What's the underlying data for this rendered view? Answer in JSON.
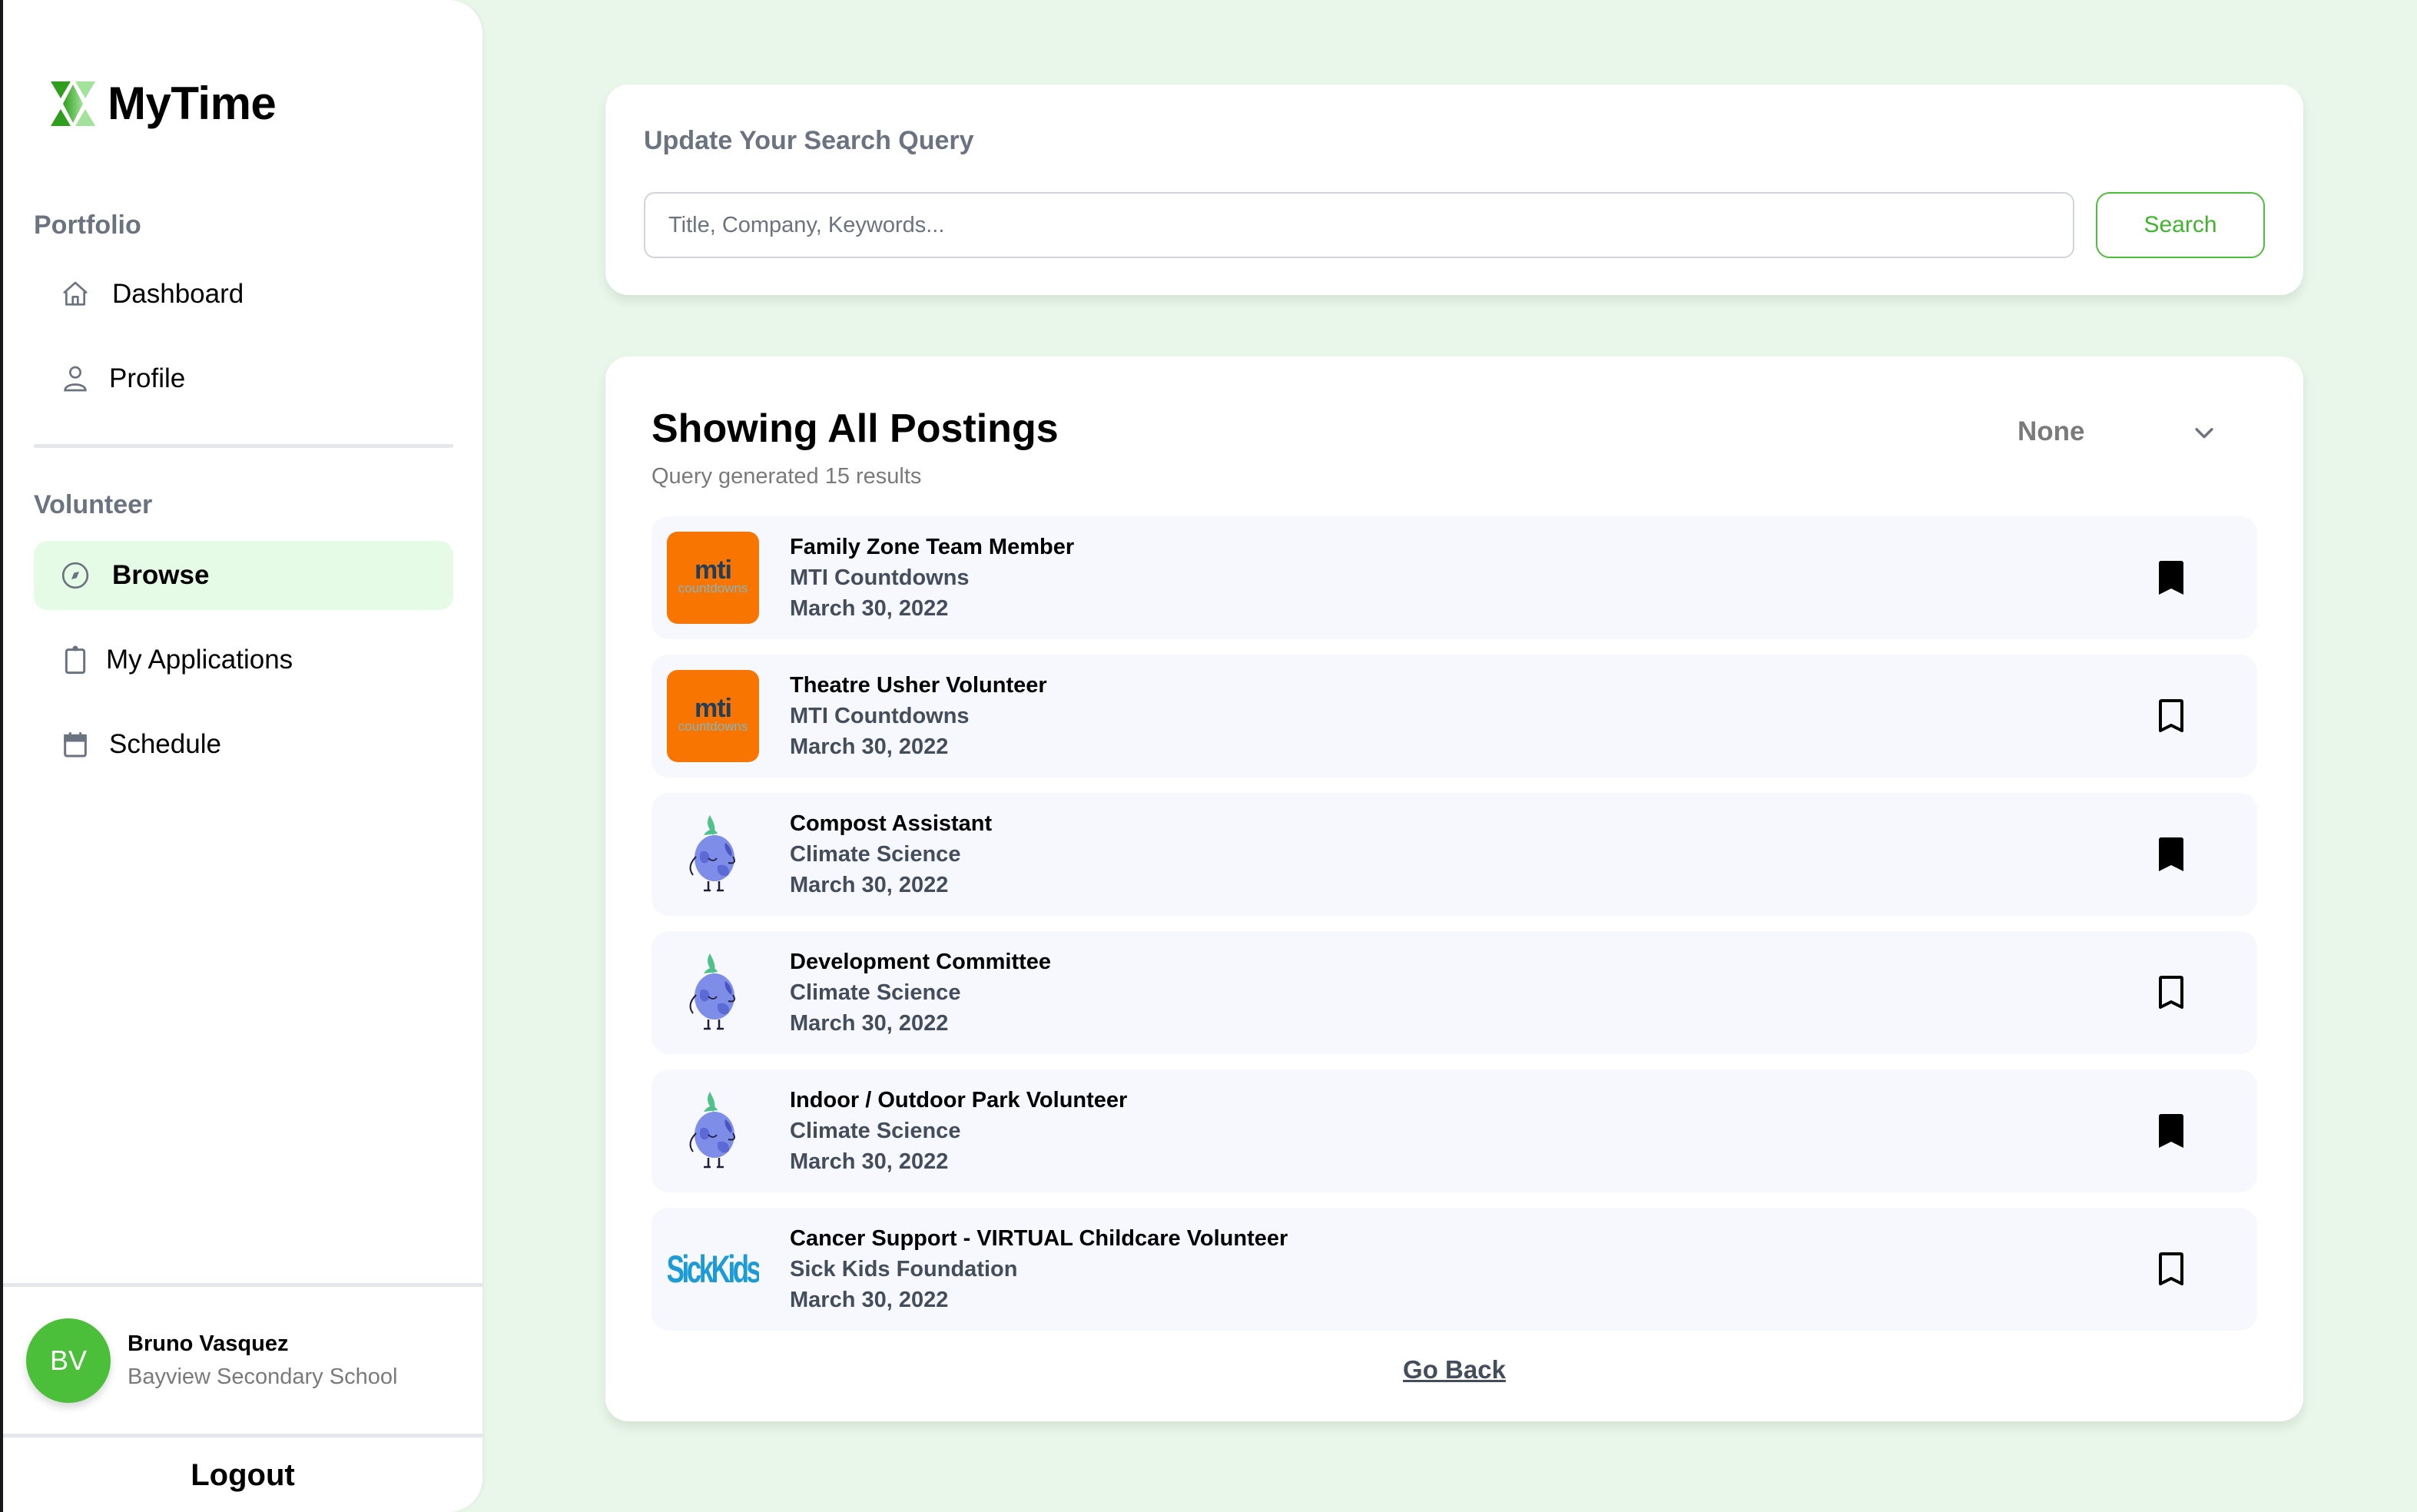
{
  "app": {
    "name": "MyTime"
  },
  "sidebar": {
    "sections": [
      {
        "label": "Portfolio",
        "items": [
          {
            "label": "Dashboard",
            "icon": "home-icon"
          },
          {
            "label": "Profile",
            "icon": "user-icon"
          }
        ]
      },
      {
        "label": "Volunteer",
        "items": [
          {
            "label": "Browse",
            "icon": "compass-icon",
            "active": true
          },
          {
            "label": "My Applications",
            "icon": "clipboard-icon"
          },
          {
            "label": "Schedule",
            "icon": "calendar-icon"
          }
        ]
      }
    ],
    "user": {
      "initials": "BV",
      "name": "Bruno Vasquez",
      "school": "Bayview Secondary School"
    },
    "logout_label": "Logout"
  },
  "search": {
    "title": "Update Your Search Query",
    "placeholder": "Title, Company, Keywords...",
    "value": "",
    "button_label": "Search"
  },
  "postings": {
    "title": "Showing All Postings",
    "subtitle": "Query generated 15 results",
    "filter_value": "None",
    "items": [
      {
        "title": "Family Zone Team Member",
        "organization": "MTI Countdowns",
        "date": "March 30, 2022",
        "logo": "mti",
        "bookmarked": true
      },
      {
        "title": "Theatre Usher Volunteer",
        "organization": "MTI Countdowns",
        "date": "March 30, 2022",
        "logo": "mti",
        "bookmarked": false
      },
      {
        "title": "Compost Assistant",
        "organization": "Climate Science",
        "date": "March 30, 2022",
        "logo": "climate",
        "bookmarked": true
      },
      {
        "title": "Development Committee",
        "organization": "Climate Science",
        "date": "March 30, 2022",
        "logo": "climate",
        "bookmarked": false
      },
      {
        "title": "Indoor / Outdoor Park Volunteer",
        "organization": "Climate Science",
        "date": "March 30, 2022",
        "logo": "climate",
        "bookmarked": true
      },
      {
        "title": "Cancer Support - VIRTUAL Childcare Volunteer",
        "organization": "Sick Kids Foundation",
        "date": "March 30, 2022",
        "logo": "sickkids",
        "bookmarked": false
      }
    ],
    "logo_text": {
      "mti": {
        "top": "mti",
        "bottom": "countdowns"
      },
      "sickkids": "SickKids"
    },
    "go_back_label": "Go Back"
  },
  "colors": {
    "accent": "#4cbf3a",
    "background": "#e9f6ea",
    "active_nav": "#e5fbe6",
    "mti_orange": "#f77500"
  }
}
